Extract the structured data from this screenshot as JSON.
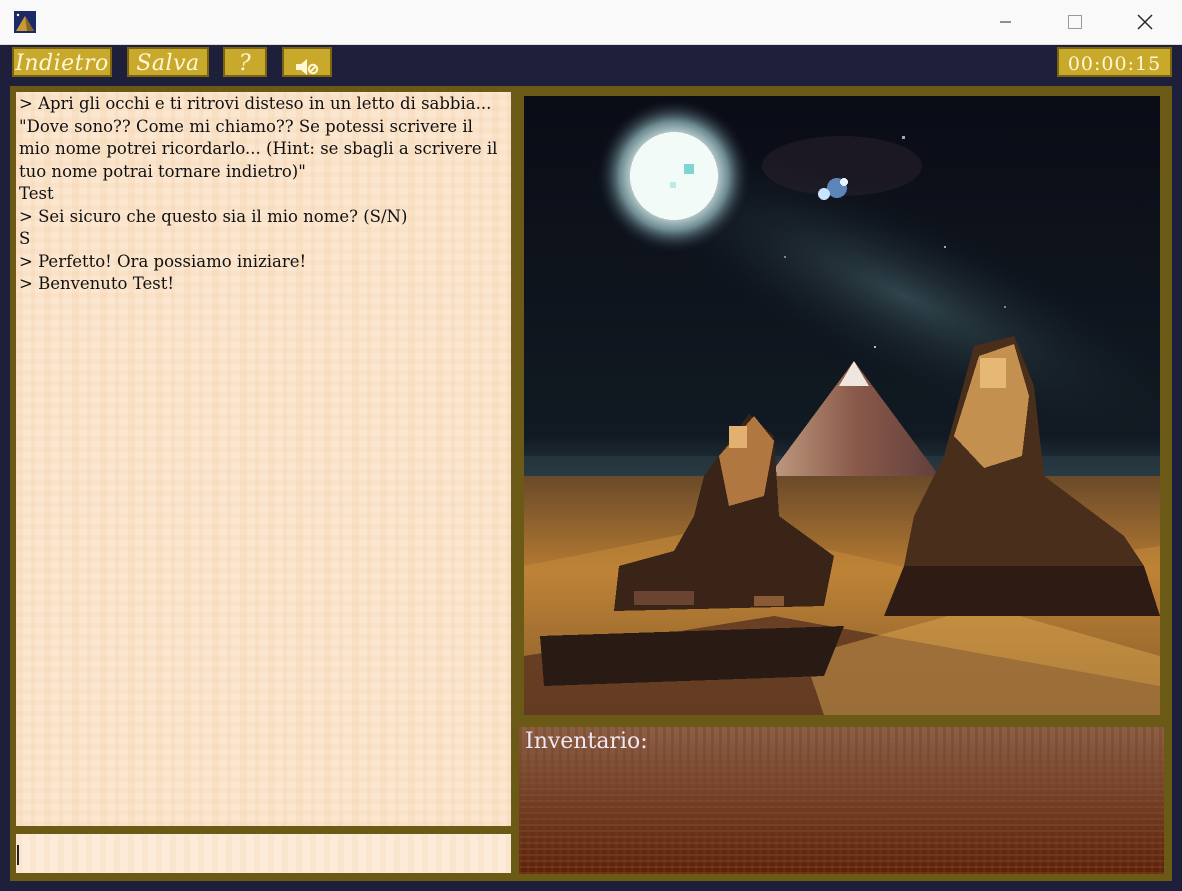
{
  "window": {
    "icon": "pyramid-app-icon",
    "controls": [
      "minimize-icon",
      "maximize-icon",
      "close-icon"
    ]
  },
  "toolbar": {
    "back_label": "Indietro",
    "save_label": "Salva",
    "help_label": "?",
    "sound_icon": "speaker-mute-icon",
    "timer": "00:00:15"
  },
  "log": {
    "lines": [
      "> Apri gli occhi e ti ritrovi disteso in un letto di sabbia... \"Dove sono?? Come mi chiamo?? Se potessi scrivere il mio nome potrei ricordarlo... (Hint: se sbagli a scrivere il tuo nome potrai tornare indietro)\"",
      "Test",
      "> Sei sicuro che questo sia il mio nome? (S/N)",
      "S",
      "> Perfetto! Ora possiamo iniziare!",
      "> Benvenuto Test!"
    ]
  },
  "input": {
    "value": ""
  },
  "inventory": {
    "label": "Inventario:",
    "items": []
  },
  "colors": {
    "background": "#1e1f3b",
    "button": "#c9a92c",
    "frame": "#6b5a16",
    "parchment": "#fbe6cf"
  }
}
